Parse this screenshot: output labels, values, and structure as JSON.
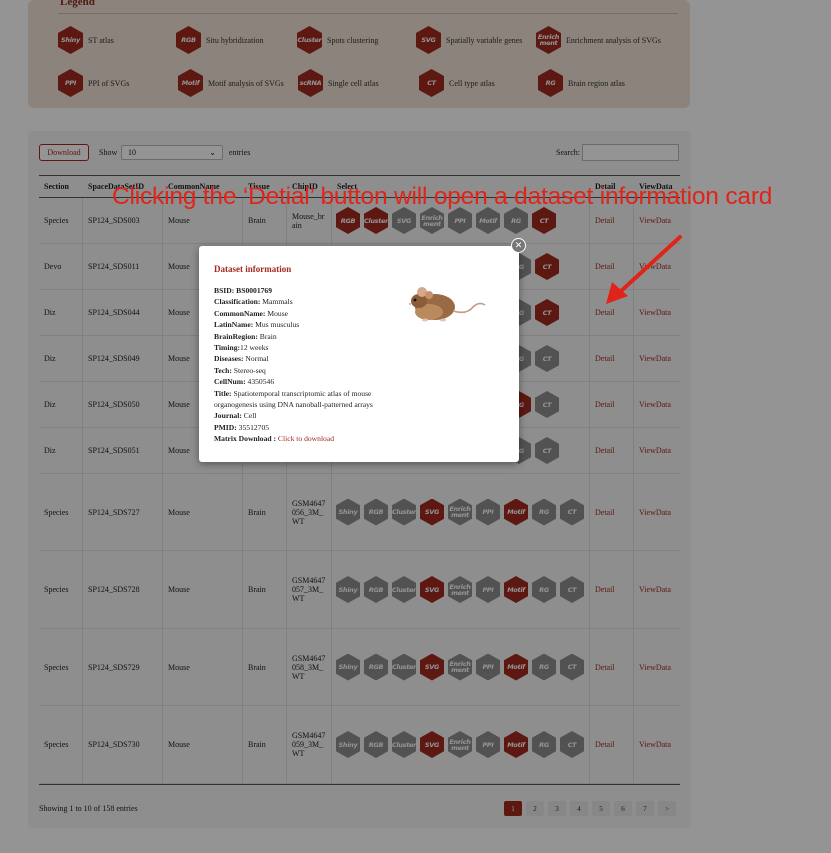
{
  "legend": {
    "title": "Legend",
    "items": [
      {
        "badge": "Shiny",
        "label": "ST atlas",
        "color": "red"
      },
      {
        "badge": "RGB",
        "label": "Situ hybridization",
        "color": "red"
      },
      {
        "badge": "Cluster",
        "label": "Spots clustering",
        "color": "red"
      },
      {
        "badge": "SVG",
        "label": "Spatially variable genes",
        "color": "red"
      },
      {
        "badge": "Enrich ment",
        "label": "Enrichment analysis of SVGs",
        "color": "red"
      },
      {
        "badge": "PPI",
        "label": "PPI of SVGs",
        "color": "red"
      },
      {
        "badge": "Motif",
        "label": "Motif analysis of SVGs",
        "color": "red"
      },
      {
        "badge": "scRNA",
        "label": "Single cell atlas",
        "color": "red"
      },
      {
        "badge": "CT",
        "label": "Cell type atlas",
        "color": "red"
      },
      {
        "badge": "RG",
        "label": "Brain region atlas",
        "color": "red"
      }
    ]
  },
  "toolbar": {
    "download": "Download",
    "show": "Show",
    "entries_value": "10",
    "entries": "entries",
    "search": "Search:"
  },
  "table": {
    "headers": [
      "Section",
      "SpaceDataSetID",
      "CommonName",
      "Tissue",
      "ChipID",
      "Select",
      "Detail",
      "ViewData"
    ],
    "rows": [
      {
        "section": "Species",
        "id": "SP124_SDS003",
        "common": "Mouse",
        "tissue": "Brain",
        "chip": "Mouse_br ain",
        "badges": [
          [
            "RGB",
            "red"
          ],
          [
            "Cluster",
            "red"
          ],
          [
            "SVG",
            "grey"
          ],
          [
            "Enrich ment",
            "grey"
          ],
          [
            "PPI",
            "grey"
          ],
          [
            "Motif",
            "grey"
          ],
          [
            "RG",
            "grey"
          ],
          [
            "CT",
            "red"
          ]
        ],
        "detail": "Detail",
        "view": "ViewData"
      },
      {
        "section": "Devo",
        "id": "SP124_SDS011",
        "common": "Mouse",
        "tissue": "",
        "chip": "",
        "badges": [
          [
            "RG",
            "grey"
          ],
          [
            "CT",
            "red"
          ]
        ],
        "detail": "Detail",
        "view": "ViewData"
      },
      {
        "section": "Diz",
        "id": "SP124_SDS044",
        "common": "Mouse",
        "tissue": "",
        "chip": "",
        "badges": [
          [
            "RG",
            "grey"
          ],
          [
            "CT",
            "red"
          ]
        ],
        "detail": "Detail",
        "view": "ViewData"
      },
      {
        "section": "Diz",
        "id": "SP124_SDS049",
        "common": "Mouse",
        "tissue": "",
        "chip": "",
        "badges": [
          [
            "RG",
            "grey"
          ],
          [
            "CT",
            "grey"
          ]
        ],
        "detail": "Detail",
        "view": "ViewData"
      },
      {
        "section": "Diz",
        "id": "SP124_SDS050",
        "common": "Mouse",
        "tissue": "",
        "chip": "",
        "badges": [
          [
            "RG",
            "red"
          ],
          [
            "CT",
            "grey"
          ]
        ],
        "detail": "Detail",
        "view": "ViewData"
      },
      {
        "section": "Diz",
        "id": "SP124_SDS051",
        "common": "Mouse",
        "tissue": "",
        "chip": "",
        "badges": [
          [
            "RG",
            "grey"
          ],
          [
            "CT",
            "grey"
          ]
        ],
        "detail": "Detail",
        "view": "ViewData"
      },
      {
        "section": "Species",
        "id": "SP124_SDS727",
        "common": "Mouse",
        "tissue": "Brain",
        "chip": "GSM4647 056_3M_ WT",
        "badges": [
          [
            "Shiny",
            "grey"
          ],
          [
            "RGB",
            "grey"
          ],
          [
            "Cluster",
            "grey"
          ],
          [
            "SVG",
            "red"
          ],
          [
            "Enrich ment",
            "grey"
          ],
          [
            "PPI",
            "grey"
          ],
          [
            "Motif",
            "red"
          ],
          [
            "RG",
            "grey"
          ],
          [
            "CT",
            "grey"
          ]
        ],
        "detail": "Detail",
        "view": "ViewData"
      },
      {
        "section": "Species",
        "id": "SP124_SDS728",
        "common": "Mouse",
        "tissue": "Brain",
        "chip": "GSM4647 057_3M_ WT",
        "badges": [
          [
            "Shiny",
            "grey"
          ],
          [
            "RGB",
            "grey"
          ],
          [
            "Cluster",
            "grey"
          ],
          [
            "SVG",
            "red"
          ],
          [
            "Enrich ment",
            "grey"
          ],
          [
            "PPI",
            "grey"
          ],
          [
            "Motif",
            "red"
          ],
          [
            "RG",
            "grey"
          ],
          [
            "CT",
            "grey"
          ]
        ],
        "detail": "Detail",
        "view": "ViewData"
      },
      {
        "section": "Species",
        "id": "SP124_SDS729",
        "common": "Mouse",
        "tissue": "Brain",
        "chip": "GSM4647 058_3M_ WT",
        "badges": [
          [
            "Shiny",
            "grey"
          ],
          [
            "RGB",
            "grey"
          ],
          [
            "Cluster",
            "grey"
          ],
          [
            "SVG",
            "red"
          ],
          [
            "Enrich ment",
            "grey"
          ],
          [
            "PPI",
            "grey"
          ],
          [
            "Motif",
            "red"
          ],
          [
            "RG",
            "grey"
          ],
          [
            "CT",
            "grey"
          ]
        ],
        "detail": "Detail",
        "view": "ViewData"
      },
      {
        "section": "Species",
        "id": "SP124_SDS730",
        "common": "Mouse",
        "tissue": "Brain",
        "chip": "GSM4647 059_3M_ WT",
        "badges": [
          [
            "Shiny",
            "grey"
          ],
          [
            "RGB",
            "grey"
          ],
          [
            "Cluster",
            "grey"
          ],
          [
            "SVG",
            "red"
          ],
          [
            "Enrich ment",
            "grey"
          ],
          [
            "PPI",
            "grey"
          ],
          [
            "Motif",
            "red"
          ],
          [
            "RG",
            "grey"
          ],
          [
            "CT",
            "grey"
          ]
        ],
        "detail": "Detail",
        "view": "ViewData"
      }
    ]
  },
  "footer": {
    "showing": "Showing 1 to 10 of 158 entries",
    "pages": [
      "1",
      "2",
      "3",
      "4",
      "5",
      "6",
      "7",
      ">"
    ],
    "active_page": "1"
  },
  "modal": {
    "title": "Dataset information",
    "close_icon": "close-icon",
    "image": "mouse-photo",
    "fields": [
      {
        "key": "BSID:",
        "value": " BS0001769",
        "bold_value": true
      },
      {
        "key": "Classification:",
        "value": " Mammals"
      },
      {
        "key": "CommonName:",
        "value": " Mouse"
      },
      {
        "key": "LatinName:",
        "value": " Mus musculus"
      },
      {
        "key": "BrainRegion:",
        "value": " Brain"
      },
      {
        "key": "Timing:",
        "value": "12 weeks"
      },
      {
        "key": "Diseases:",
        "value": " Normal"
      },
      {
        "key": "Tech:",
        "value": " Stereo-seq"
      },
      {
        "key": "CellNum:",
        "value": " 4350546"
      },
      {
        "key": "Title:",
        "value": " Spatiotemporal transcriptomic atlas of mouse organogenesis using DNA nanoball-patterned arrays"
      },
      {
        "key": "Journal:",
        "value": " Cell"
      },
      {
        "key": "PMID:",
        "value": " 35512705"
      }
    ],
    "download_key": "Matrix Download :",
    "download_link": "Click to download"
  },
  "annotation": {
    "text": "Clicking the ‘Detial’ button will open a dataset information card",
    "color": "#e0241a"
  },
  "colors": {
    "accent": "#a32a1f",
    "inactive": "#8e8e8e",
    "legend_bg": "#efe2d6"
  }
}
